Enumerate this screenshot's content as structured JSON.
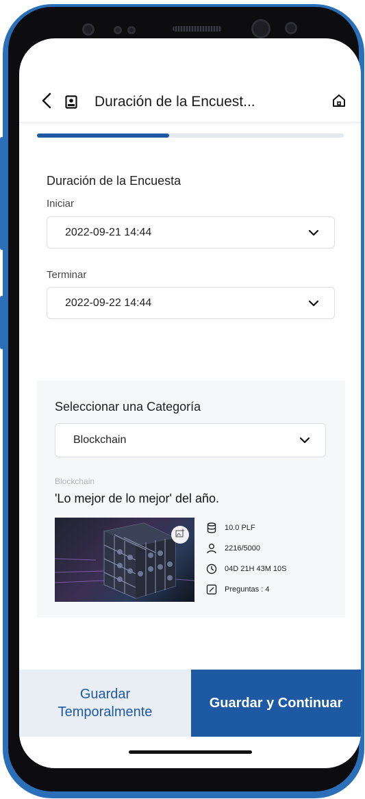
{
  "header": {
    "title": "Duración de la Encuest...",
    "back_icon": "chevron-left-icon",
    "badge_icon": "id-badge-icon",
    "home_icon": "home-icon"
  },
  "progress": {
    "value_percent": 43
  },
  "form": {
    "section_title": "Duración de la Encuesta",
    "start": {
      "label": "Iniciar",
      "value": "2022-09-21 14:44"
    },
    "end": {
      "label": "Terminar",
      "value": "2022-09-22 14:44"
    }
  },
  "category": {
    "title": "Seleccionar una Categoría",
    "selected": "Blockchain",
    "card": {
      "category_label": "Blockchain",
      "headline": "'Lo mejor de lo mejor' del año.",
      "stats": {
        "reward": "10.0 PLF",
        "participants": "2216/5000",
        "time_left": "04D 21H 43M 10S",
        "questions": "Preguntas : 4"
      }
    }
  },
  "actions": {
    "save_temp": "Guardar Temporalmente",
    "save_continue": "Guardar y Continuar"
  },
  "colors": {
    "accent": "#1d5aa3",
    "frame": "#2a6fb7",
    "secondary_button_bg": "#e9eef4"
  }
}
